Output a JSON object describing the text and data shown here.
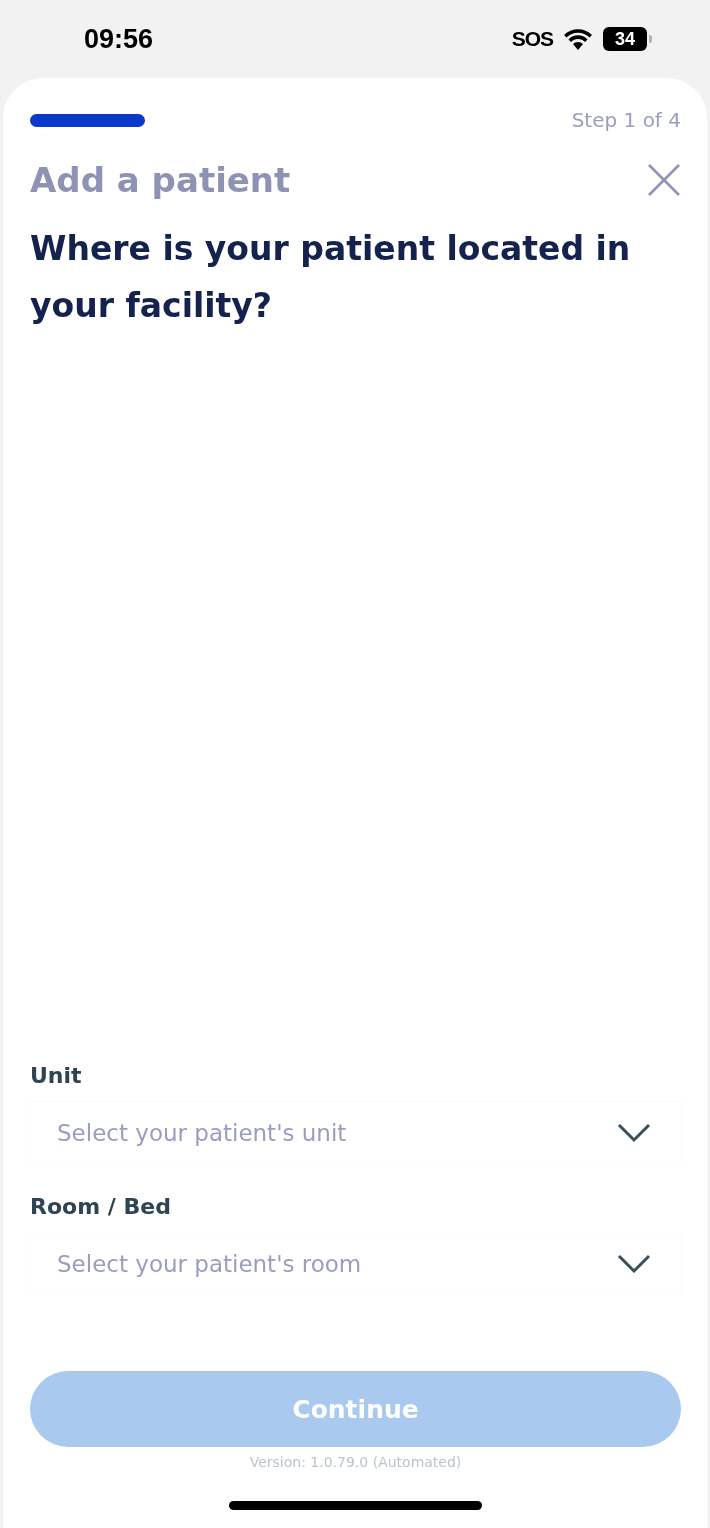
{
  "status_bar": {
    "time": "09:56",
    "carrier": "SOS",
    "battery": "34"
  },
  "progress": {
    "label": "Step 1 of 4"
  },
  "title": "Add a patient",
  "question": "Where is your patient located in your facility?",
  "fields": [
    {
      "label": "Unit",
      "placeholder": "Select your patient's unit"
    },
    {
      "label": "Room / Bed",
      "placeholder": "Select your patient's room"
    }
  ],
  "continue_button": {
    "label": "Continue",
    "disabled": true
  },
  "version": "Version: 1.0.79.0 (Automated)"
}
